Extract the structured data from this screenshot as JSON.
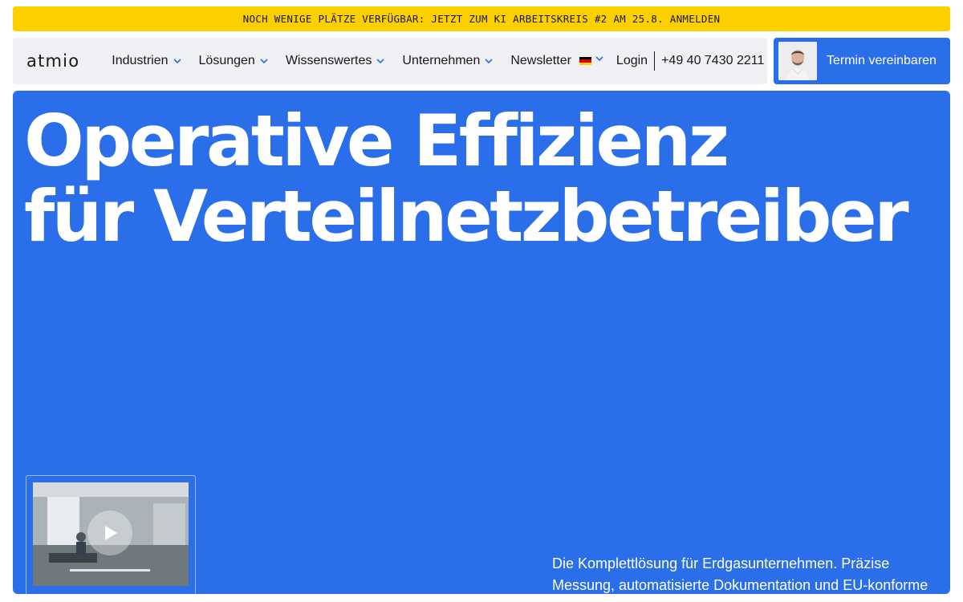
{
  "announcement": {
    "text": "NOCH WENIGE PLÄTZE VERFÜGBAR: JETZT ZUM KI ARBEITSKREIS #2 AM 25.8. ANMELDEN"
  },
  "nav": {
    "logo": "atmio",
    "items": [
      {
        "label": "Industrien",
        "has_dropdown": true
      },
      {
        "label": "Lösungen",
        "has_dropdown": true
      },
      {
        "label": "Wissenswertes",
        "has_dropdown": true
      },
      {
        "label": "Unternehmen",
        "has_dropdown": true
      },
      {
        "label": "Newsletter",
        "has_dropdown": false
      }
    ],
    "language_icon": "german-flag-icon",
    "login": "Login",
    "phone": "+49 40 7430 2211"
  },
  "cta": {
    "label": "Termin vereinbaren",
    "icon": "person-avatar"
  },
  "hero": {
    "title_line1": "Operative Effizienz",
    "title_line2": "für Verteilnetzbetreiber",
    "subtitle": "Die Komplettlösung für Erdgasunternehmen. Präzise Messung, automatisierte Dokumentation und EU-konforme",
    "video_icon": "play-icon"
  },
  "colors": {
    "accent_blue": "#2a6ee9",
    "announcement_yellow": "#ffd000",
    "nav_background": "#eef0f4",
    "text_dark": "#16181d"
  }
}
